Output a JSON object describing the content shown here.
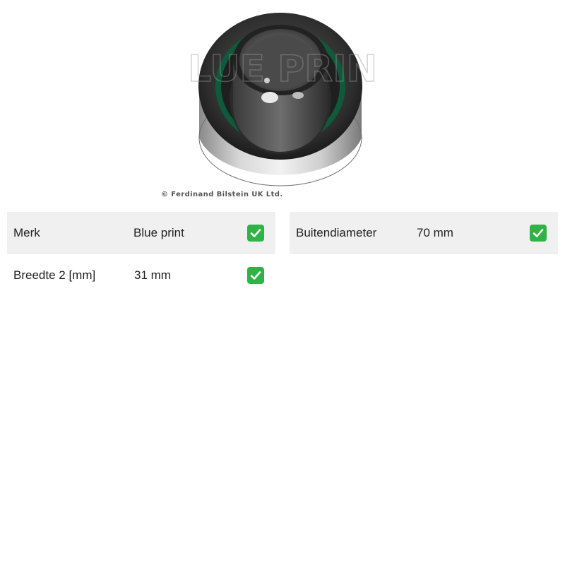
{
  "product": {
    "image_icon": "tensioner-pulley-image",
    "watermark": "BLUE PRINT",
    "copyright": "© Ferdinand Bilstein UK Ltd."
  },
  "specs": [
    {
      "label": "Merk",
      "value": "Blue print",
      "status_icon": "check-mark-icon"
    },
    {
      "label": "Buitendiameter",
      "value": "70 mm",
      "status_icon": "check-mark-icon"
    },
    {
      "label": "Breedte 2 [mm]",
      "value": "31 mm",
      "status_icon": "check-mark-icon"
    }
  ],
  "colors": {
    "row_background": "#f0f0f0",
    "check_green": "#2fb344",
    "pulley_accent": "#0f5a3a"
  }
}
